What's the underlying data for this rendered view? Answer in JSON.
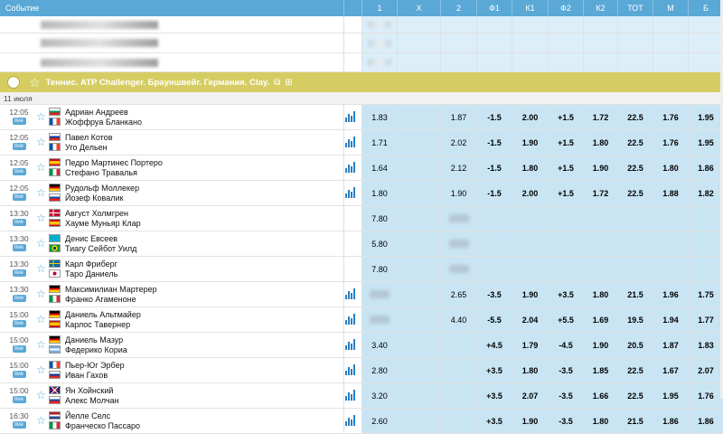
{
  "header": {
    "event_label": "Событие",
    "columns": [
      "1",
      "X",
      "2",
      "Ф1",
      "К1",
      "Ф2",
      "К2",
      "ТОТ",
      "М",
      "Б"
    ]
  },
  "tournament": {
    "name": "Теннис. ATP Challenger. Брауншвейг. Германия. Clay."
  },
  "date_label": "11 июля",
  "live_label": "live",
  "matches": [
    {
      "time": "12:05",
      "p1": "Адриан Андреев",
      "p2": "Жоффруа Бланкано",
      "f1": "bg",
      "f2": "fr",
      "stats": true,
      "o1": "1.83",
      "ox": "",
      "o2": "1.87",
      "h1": "-1.5",
      "k1": "2.00",
      "h2": "+1.5",
      "k2": "1.72",
      "tot": "22.5",
      "m": "1.76",
      "b": "1.95"
    },
    {
      "time": "12:05",
      "p1": "Павел Котов",
      "p2": "Уго Дельен",
      "f1": "ru",
      "f2": "bo",
      "stats": true,
      "o1": "1.71",
      "ox": "",
      "o2": "2.02",
      "h1": "-1.5",
      "k1": "1.90",
      "h2": "+1.5",
      "k2": "1.80",
      "tot": "22.5",
      "m": "1.76",
      "b": "1.95"
    },
    {
      "time": "12:05",
      "p1": "Педро Мартинес Портеро",
      "p2": "Стефано Травалья",
      "f1": "es",
      "f2": "it",
      "stats": true,
      "o1": "1.64",
      "ox": "",
      "o2": "2.12",
      "h1": "-1.5",
      "k1": "1.80",
      "h2": "+1.5",
      "k2": "1.90",
      "tot": "22.5",
      "m": "1.80",
      "b": "1.86"
    },
    {
      "time": "12:05",
      "p1": "Рудольф Моллекер",
      "p2": "Йозеф Ковалик",
      "f1": "de",
      "f2": "sk",
      "stats": true,
      "o1": "1.80",
      "ox": "",
      "o2": "1.90",
      "h1": "-1.5",
      "k1": "2.00",
      "h2": "+1.5",
      "k2": "1.72",
      "tot": "22.5",
      "m": "1.88",
      "b": "1.82"
    },
    {
      "time": "13:30",
      "p1": "Август Холмгрен",
      "p2": "Хауме Муньяр Клар",
      "f1": "dk",
      "f2": "es",
      "stats": false,
      "o1": "7.80",
      "ox": "",
      "o2": "",
      "h1": "",
      "k1": "",
      "h2": "",
      "k2": "",
      "tot": "",
      "m": "",
      "b": ""
    },
    {
      "time": "13:30",
      "p1": "Денис Евсеев",
      "p2": "Тиагу Сейбот Уилд",
      "f1": "kz",
      "f2": "br",
      "stats": false,
      "o1": "5.80",
      "ox": "",
      "o2": "",
      "h1": "",
      "k1": "",
      "h2": "",
      "k2": "",
      "tot": "",
      "m": "",
      "b": ""
    },
    {
      "time": "13:30",
      "p1": "Карл Фриберг",
      "p2": "Таро Даниель",
      "f1": "se",
      "f2": "jp",
      "stats": false,
      "o1": "7.80",
      "ox": "",
      "o2": "",
      "h1": "",
      "k1": "",
      "h2": "",
      "k2": "",
      "tot": "",
      "m": "",
      "b": ""
    },
    {
      "time": "13:30",
      "p1": "Максимилиан Мартерер",
      "p2": "Франко Агаменоне",
      "f1": "de",
      "f2": "it",
      "stats": true,
      "o1": "",
      "ox": "",
      "o2": "2.65",
      "h1": "-3.5",
      "k1": "1.90",
      "h2": "+3.5",
      "k2": "1.80",
      "tot": "21.5",
      "m": "1.96",
      "b": "1.75"
    },
    {
      "time": "15:00",
      "p1": "Даниель Альтмайер",
      "p2": "Карлос Тавернер",
      "f1": "de",
      "f2": "es",
      "stats": true,
      "o1": "",
      "ox": "",
      "o2": "4.40",
      "h1": "-5.5",
      "k1": "2.04",
      "h2": "+5.5",
      "k2": "1.69",
      "tot": "19.5",
      "m": "1.94",
      "b": "1.77"
    },
    {
      "time": "15:00",
      "p1": "Даниель Мазур",
      "p2": "Федерико Кориа",
      "f1": "de",
      "f2": "ar",
      "stats": true,
      "o1": "3.40",
      "ox": "",
      "o2": "",
      "h1": "+4.5",
      "k1": "1.79",
      "h2": "-4.5",
      "k2": "1.90",
      "tot": "20.5",
      "m": "1.87",
      "b": "1.83"
    },
    {
      "time": "15:00",
      "p1": "Пьер-Юг Эрбер",
      "p2": "Иван Гахов",
      "f1": "fr",
      "f2": "ru",
      "stats": true,
      "o1": "2.80",
      "ox": "",
      "o2": "",
      "h1": "+3.5",
      "k1": "1.80",
      "h2": "-3.5",
      "k2": "1.85",
      "tot": "22.5",
      "m": "1.67",
      "b": "2.07"
    },
    {
      "time": "15:00",
      "p1": "Ян Хойнский",
      "p2": "Алекс Молчан",
      "f1": "gb",
      "f2": "sk",
      "stats": true,
      "o1": "3.20",
      "ox": "",
      "o2": "",
      "h1": "+3.5",
      "k1": "2.07",
      "h2": "-3.5",
      "k2": "1.66",
      "tot": "22.5",
      "m": "1.95",
      "b": "1.76"
    },
    {
      "time": "16:30",
      "p1": "Йелле Селс",
      "p2": "Франческо Пассаро",
      "f1": "nl",
      "f2": "it",
      "stats": true,
      "o1": "2.60",
      "ox": "",
      "o2": "",
      "h1": "+3.5",
      "k1": "1.90",
      "h2": "-3.5",
      "k2": "1.80",
      "tot": "21.5",
      "m": "1.86",
      "b": "1.86"
    }
  ]
}
